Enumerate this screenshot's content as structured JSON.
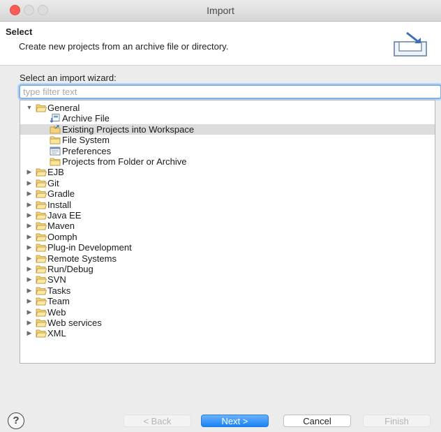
{
  "window": {
    "title": "Import"
  },
  "header": {
    "title": "Select",
    "description": "Create new projects from an archive file or directory."
  },
  "wizard": {
    "label": "Select an import wizard:",
    "filter_placeholder": "type filter text",
    "filter_value": ""
  },
  "tree": {
    "items": [
      {
        "label": "General",
        "level": 0,
        "expanded": true,
        "icon": "folder-open-icon",
        "selected": false
      },
      {
        "label": "Archive File",
        "level": 1,
        "icon": "archive-file-icon",
        "selected": false
      },
      {
        "label": "Existing Projects into Workspace",
        "level": 1,
        "icon": "existing-projects-icon",
        "selected": true
      },
      {
        "label": "File System",
        "level": 1,
        "icon": "folder-icon",
        "selected": false
      },
      {
        "label": "Preferences",
        "level": 1,
        "icon": "preferences-icon",
        "selected": false
      },
      {
        "label": "Projects from Folder or Archive",
        "level": 1,
        "icon": "folder-icon",
        "selected": false
      },
      {
        "label": "EJB",
        "level": 0,
        "expanded": false,
        "icon": "folder-open-icon",
        "selected": false
      },
      {
        "label": "Git",
        "level": 0,
        "expanded": false,
        "icon": "folder-open-icon",
        "selected": false
      },
      {
        "label": "Gradle",
        "level": 0,
        "expanded": false,
        "icon": "folder-open-icon",
        "selected": false
      },
      {
        "label": "Install",
        "level": 0,
        "expanded": false,
        "icon": "folder-open-icon",
        "selected": false
      },
      {
        "label": "Java EE",
        "level": 0,
        "expanded": false,
        "icon": "folder-open-icon",
        "selected": false
      },
      {
        "label": "Maven",
        "level": 0,
        "expanded": false,
        "icon": "folder-open-icon",
        "selected": false
      },
      {
        "label": "Oomph",
        "level": 0,
        "expanded": false,
        "icon": "folder-open-icon",
        "selected": false
      },
      {
        "label": "Plug-in Development",
        "level": 0,
        "expanded": false,
        "icon": "folder-open-icon",
        "selected": false
      },
      {
        "label": "Remote Systems",
        "level": 0,
        "expanded": false,
        "icon": "folder-open-icon",
        "selected": false
      },
      {
        "label": "Run/Debug",
        "level": 0,
        "expanded": false,
        "icon": "folder-open-icon",
        "selected": false
      },
      {
        "label": "SVN",
        "level": 0,
        "expanded": false,
        "icon": "folder-open-icon",
        "selected": false
      },
      {
        "label": "Tasks",
        "level": 0,
        "expanded": false,
        "icon": "folder-open-icon",
        "selected": false
      },
      {
        "label": "Team",
        "level": 0,
        "expanded": false,
        "icon": "folder-open-icon",
        "selected": false
      },
      {
        "label": "Web",
        "level": 0,
        "expanded": false,
        "icon": "folder-open-icon",
        "selected": false
      },
      {
        "label": "Web services",
        "level": 0,
        "expanded": false,
        "icon": "folder-open-icon",
        "selected": false
      },
      {
        "label": "XML",
        "level": 0,
        "expanded": false,
        "icon": "folder-open-icon",
        "selected": false
      }
    ]
  },
  "footer": {
    "help_label": "?",
    "back_label": "< Back",
    "next_label": "Next >",
    "cancel_label": "Cancel",
    "finish_label": "Finish"
  },
  "colors": {
    "accent": "#1782f6",
    "close": "#fc5c56",
    "selection": "#dcdcdc",
    "focus": "#7fb1ea"
  }
}
